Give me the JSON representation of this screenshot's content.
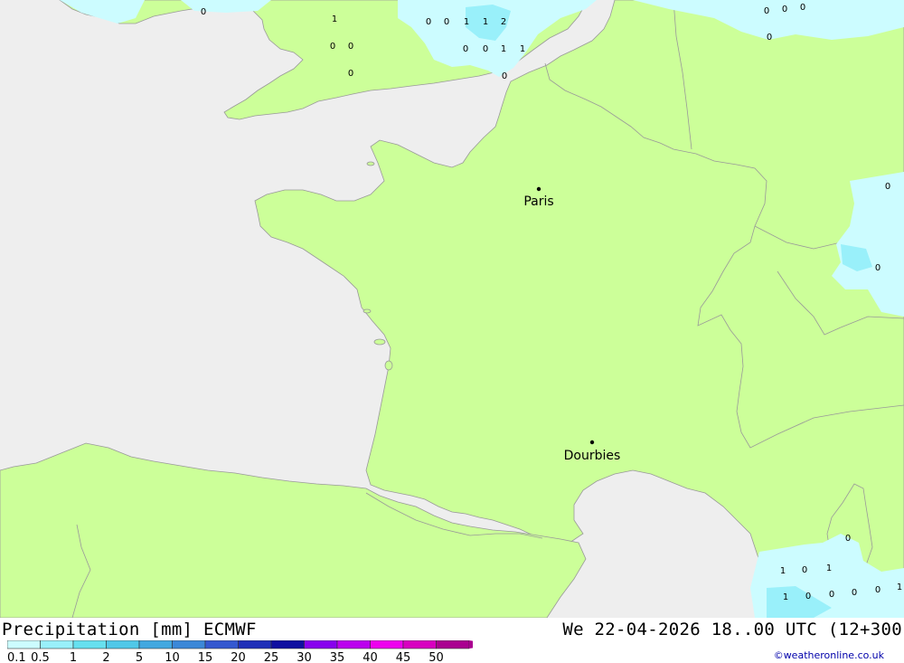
{
  "map": {
    "colors": {
      "sea": "#eeeeee",
      "land": "#ccff99",
      "border": "#999999",
      "precip_light": "#ccfcff",
      "precip_medium": "#99f0fa"
    },
    "cities": [
      {
        "name": "Paris"
      },
      {
        "name": "Dourbies"
      }
    ],
    "point_values": [
      "0",
      "1",
      "0",
      "0",
      "0",
      "0",
      "0",
      "1",
      "1",
      "2",
      "0",
      "0",
      "1",
      "1",
      "0",
      "0",
      "0",
      "0",
      "0",
      "0",
      "0",
      "0",
      "1",
      "0",
      "1",
      "1",
      "0",
      "0",
      "0",
      "0",
      "1"
    ]
  },
  "footer": {
    "title_left": "Precipitation [mm] ECMWF",
    "title_right": "We 22-04-2026 18..00 UTC (12+300",
    "copyright": "©weatheronline.co.uk"
  },
  "legend": {
    "labels": [
      "0.1",
      "0.5",
      "1",
      "2",
      "5",
      "10",
      "15",
      "20",
      "25",
      "30",
      "35",
      "40",
      "45",
      "50"
    ],
    "colors": [
      "#ccfcff",
      "#99f0fa",
      "#66e0ef",
      "#50c8e8",
      "#42a8e0",
      "#3c88d8",
      "#3458d0",
      "#2030b8",
      "#1010a0",
      "#8800ee",
      "#bb00ee",
      "#ee00ee",
      "#d800c0",
      "#aa0090"
    ]
  }
}
